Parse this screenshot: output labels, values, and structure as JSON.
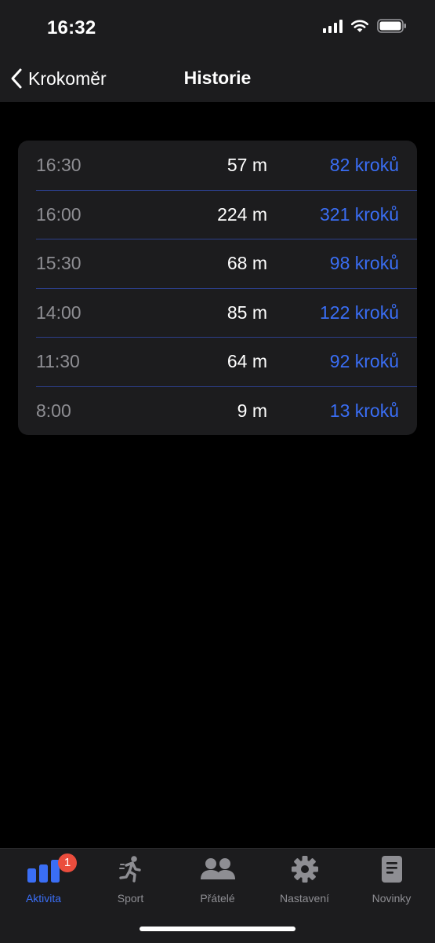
{
  "status_bar": {
    "time": "16:32"
  },
  "nav": {
    "back_label": "Krokoměr",
    "title": "Historie"
  },
  "history": [
    {
      "time": "16:30",
      "distance": "57 m",
      "steps": "82 kroků"
    },
    {
      "time": "16:00",
      "distance": "224 m",
      "steps": "321 kroků"
    },
    {
      "time": "15:30",
      "distance": "68 m",
      "steps": "98 kroků"
    },
    {
      "time": "14:00",
      "distance": "85 m",
      "steps": "122 kroků"
    },
    {
      "time": "11:30",
      "distance": "64 m",
      "steps": "92 kroků"
    },
    {
      "time": "8:00",
      "distance": "9 m",
      "steps": "13 kroků"
    }
  ],
  "tab_bar": {
    "tabs": [
      {
        "label": "Aktivita",
        "icon": "activity-bars-icon",
        "active": true,
        "badge": "1"
      },
      {
        "label": "Sport",
        "icon": "running-person-icon",
        "active": false
      },
      {
        "label": "Přátelé",
        "icon": "friends-icon",
        "active": false
      },
      {
        "label": "Nastavení",
        "icon": "gear-icon",
        "active": false
      },
      {
        "label": "Novinky",
        "icon": "news-document-icon",
        "active": false
      }
    ]
  },
  "colors": {
    "accent": "#3a6ef5",
    "badge": "#eb4d3d",
    "background": "#000000",
    "surface": "#1c1c1e",
    "secondary_text": "#8e8e93"
  }
}
